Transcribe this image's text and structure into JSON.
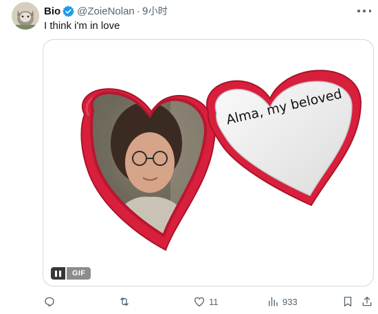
{
  "tweet": {
    "display_name": "Bio",
    "handle": "@ZoieNolan",
    "separator": "·",
    "time": "9小时",
    "text": "I think i'm in love",
    "media": {
      "caption": "Alma, my beloved",
      "gif_label": "GIF"
    },
    "actions": {
      "likes": "11",
      "views": "933"
    }
  },
  "colors": {
    "verified": "#1d9bf0",
    "secondary_text": "#536471",
    "locket_red": "#d81f3c"
  },
  "icons": {
    "reply": "reply-icon",
    "retweet": "retweet-icon",
    "like": "heart-icon",
    "views": "views-icon",
    "bookmark": "bookmark-icon",
    "share": "share-icon",
    "more": "more-icon",
    "verified": "verified-badge-icon"
  }
}
